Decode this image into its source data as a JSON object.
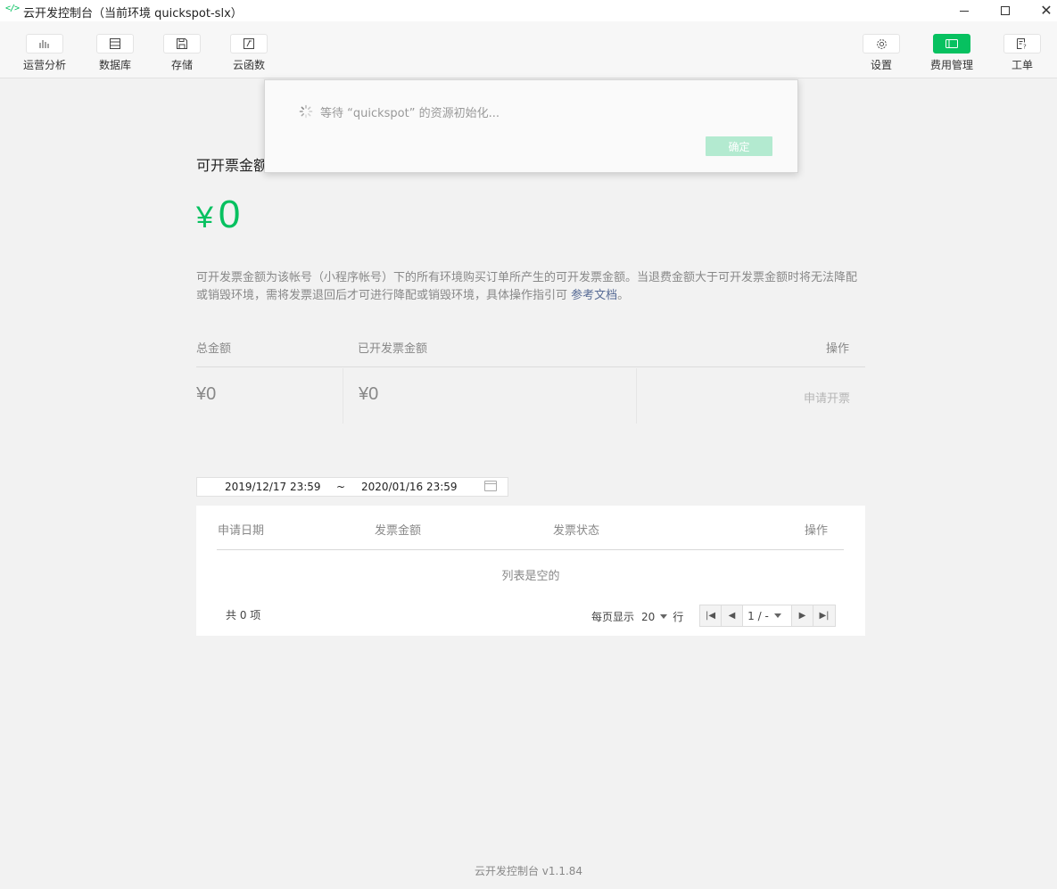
{
  "window": {
    "title": "云开发控制台（当前环境 quickspot-slx）",
    "app_icon": "</>"
  },
  "toolbar": {
    "left": [
      {
        "label": "运营分析",
        "icon": "bar-chart-icon"
      },
      {
        "label": "数据库",
        "icon": "database-icon"
      },
      {
        "label": "存储",
        "icon": "storage-icon"
      },
      {
        "label": "云函数",
        "icon": "function-icon"
      }
    ],
    "right": [
      {
        "label": "设置",
        "icon": "gear-icon"
      },
      {
        "label": "费用管理",
        "icon": "billing-icon",
        "active": true
      },
      {
        "label": "工单",
        "icon": "ticket-icon"
      }
    ]
  },
  "invoice": {
    "title": "可开票金额",
    "currency": "¥",
    "amount": "0",
    "description": "可开发票金额为该帐号（小程序帐号）下的所有环境购买订单所产生的可开发票金额。当退费金额大于可开发票金额时将无法降配或销毁环境，需将发票退回后才可进行降配或销毁环境，具体操作指引可 ",
    "doc_link": "参考文档",
    "description_end": "。"
  },
  "summary": {
    "headers": {
      "total": "总金额",
      "issued": "已开发票金额",
      "action": "操作"
    },
    "total_value": "¥0",
    "issued_value": "¥0",
    "apply_button": "申请开票"
  },
  "date_range": {
    "start": "2019/12/17 23:59",
    "separator": "~",
    "end": "2020/01/16 23:59"
  },
  "table": {
    "headers": {
      "date": "申请日期",
      "amount": "发票金额",
      "status": "发票状态",
      "action": "操作"
    },
    "empty_text": "列表是空的",
    "total_text": "共 0 项",
    "per_page_label": "每页显示",
    "per_page_value": "20",
    "rows_label": "行",
    "page_indicator": "1 / -"
  },
  "footer": {
    "version_text": "云开发控制台 v1.1.84"
  },
  "modal": {
    "message": "等待 “quickspot” 的资源初始化...",
    "ok_label": "确定"
  },
  "colors": {
    "accent": "#07c160",
    "link": "#576b95",
    "ok_disabled": "#b3ead0"
  }
}
